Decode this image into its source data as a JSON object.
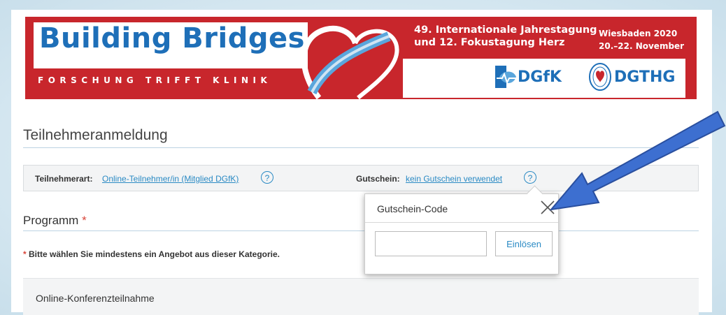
{
  "banner": {
    "brand_title": "Building Bridges",
    "brand_subtitle": "FORSCHUNG TRIFFT KLINIK",
    "conference_line1": "49. Internationale Jahrestagung",
    "conference_line2": "und 12. Fokustagung Herz",
    "place_line1": "Wiesbaden 2020",
    "place_line2": "20.–22. November",
    "logo1": "DGfK",
    "logo2": "DGTHG",
    "colors": {
      "red": "#c8262c",
      "blue": "#1e6fb8"
    }
  },
  "page_title": "Teilnehmeranmeldung",
  "infobar": {
    "participant_label": "Teilnehmerart:",
    "participant_value": "Online-Teilnehmer/in (Mitglied DGfK)",
    "voucher_label": "Gutschein:",
    "voucher_value": "kein Gutschein verwendet",
    "help_glyph": "?"
  },
  "program": {
    "title": "Programm",
    "required_star": "*",
    "note_star": "*",
    "note": "Bitte wählen Sie mindestens ein Angebot aus dieser Kategorie.",
    "offer_title": "Online-Konferenzteilnahme"
  },
  "popup": {
    "title": "Gutschein-Code",
    "input_value": "",
    "input_placeholder": "",
    "redeem_label": "Einlösen",
    "close_icon": "close-icon"
  },
  "annotation": {
    "arrow_color": "#3d6fd0",
    "icon": "arrow-icon"
  }
}
